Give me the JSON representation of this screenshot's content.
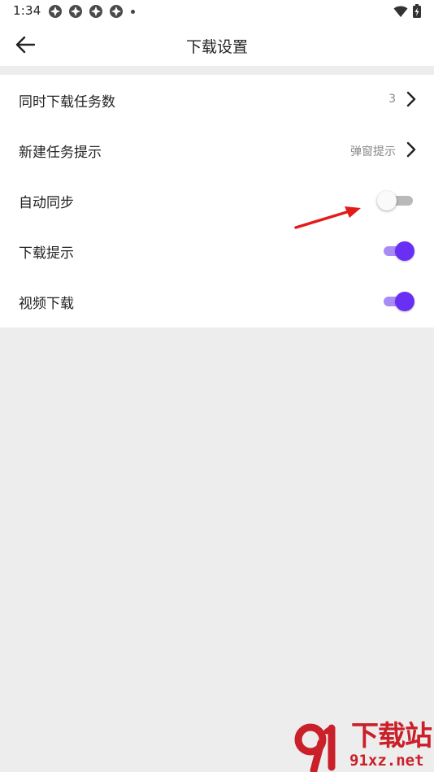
{
  "status_bar": {
    "time": "1:34",
    "app_icon_count": 4
  },
  "header": {
    "title": "下载设置",
    "back_icon": "arrow-left-icon"
  },
  "settings": {
    "concurrent_tasks": {
      "label": "同时下载任务数",
      "value": "3"
    },
    "new_task_prompt": {
      "label": "新建任务提示",
      "value": "弹窗提示"
    },
    "auto_sync": {
      "label": "自动同步",
      "enabled": false
    },
    "download_prompt": {
      "label": "下载提示",
      "enabled": true
    },
    "video_download": {
      "label": "视频下载",
      "enabled": true
    }
  },
  "watermark": {
    "text": "下载站",
    "url": "91xz.net"
  },
  "colors": {
    "accent": "#6a2ff5",
    "accent_track": "#a98bf7",
    "annotation": "#e21b1b",
    "background": "#ededed",
    "watermark": "#c9202a"
  }
}
